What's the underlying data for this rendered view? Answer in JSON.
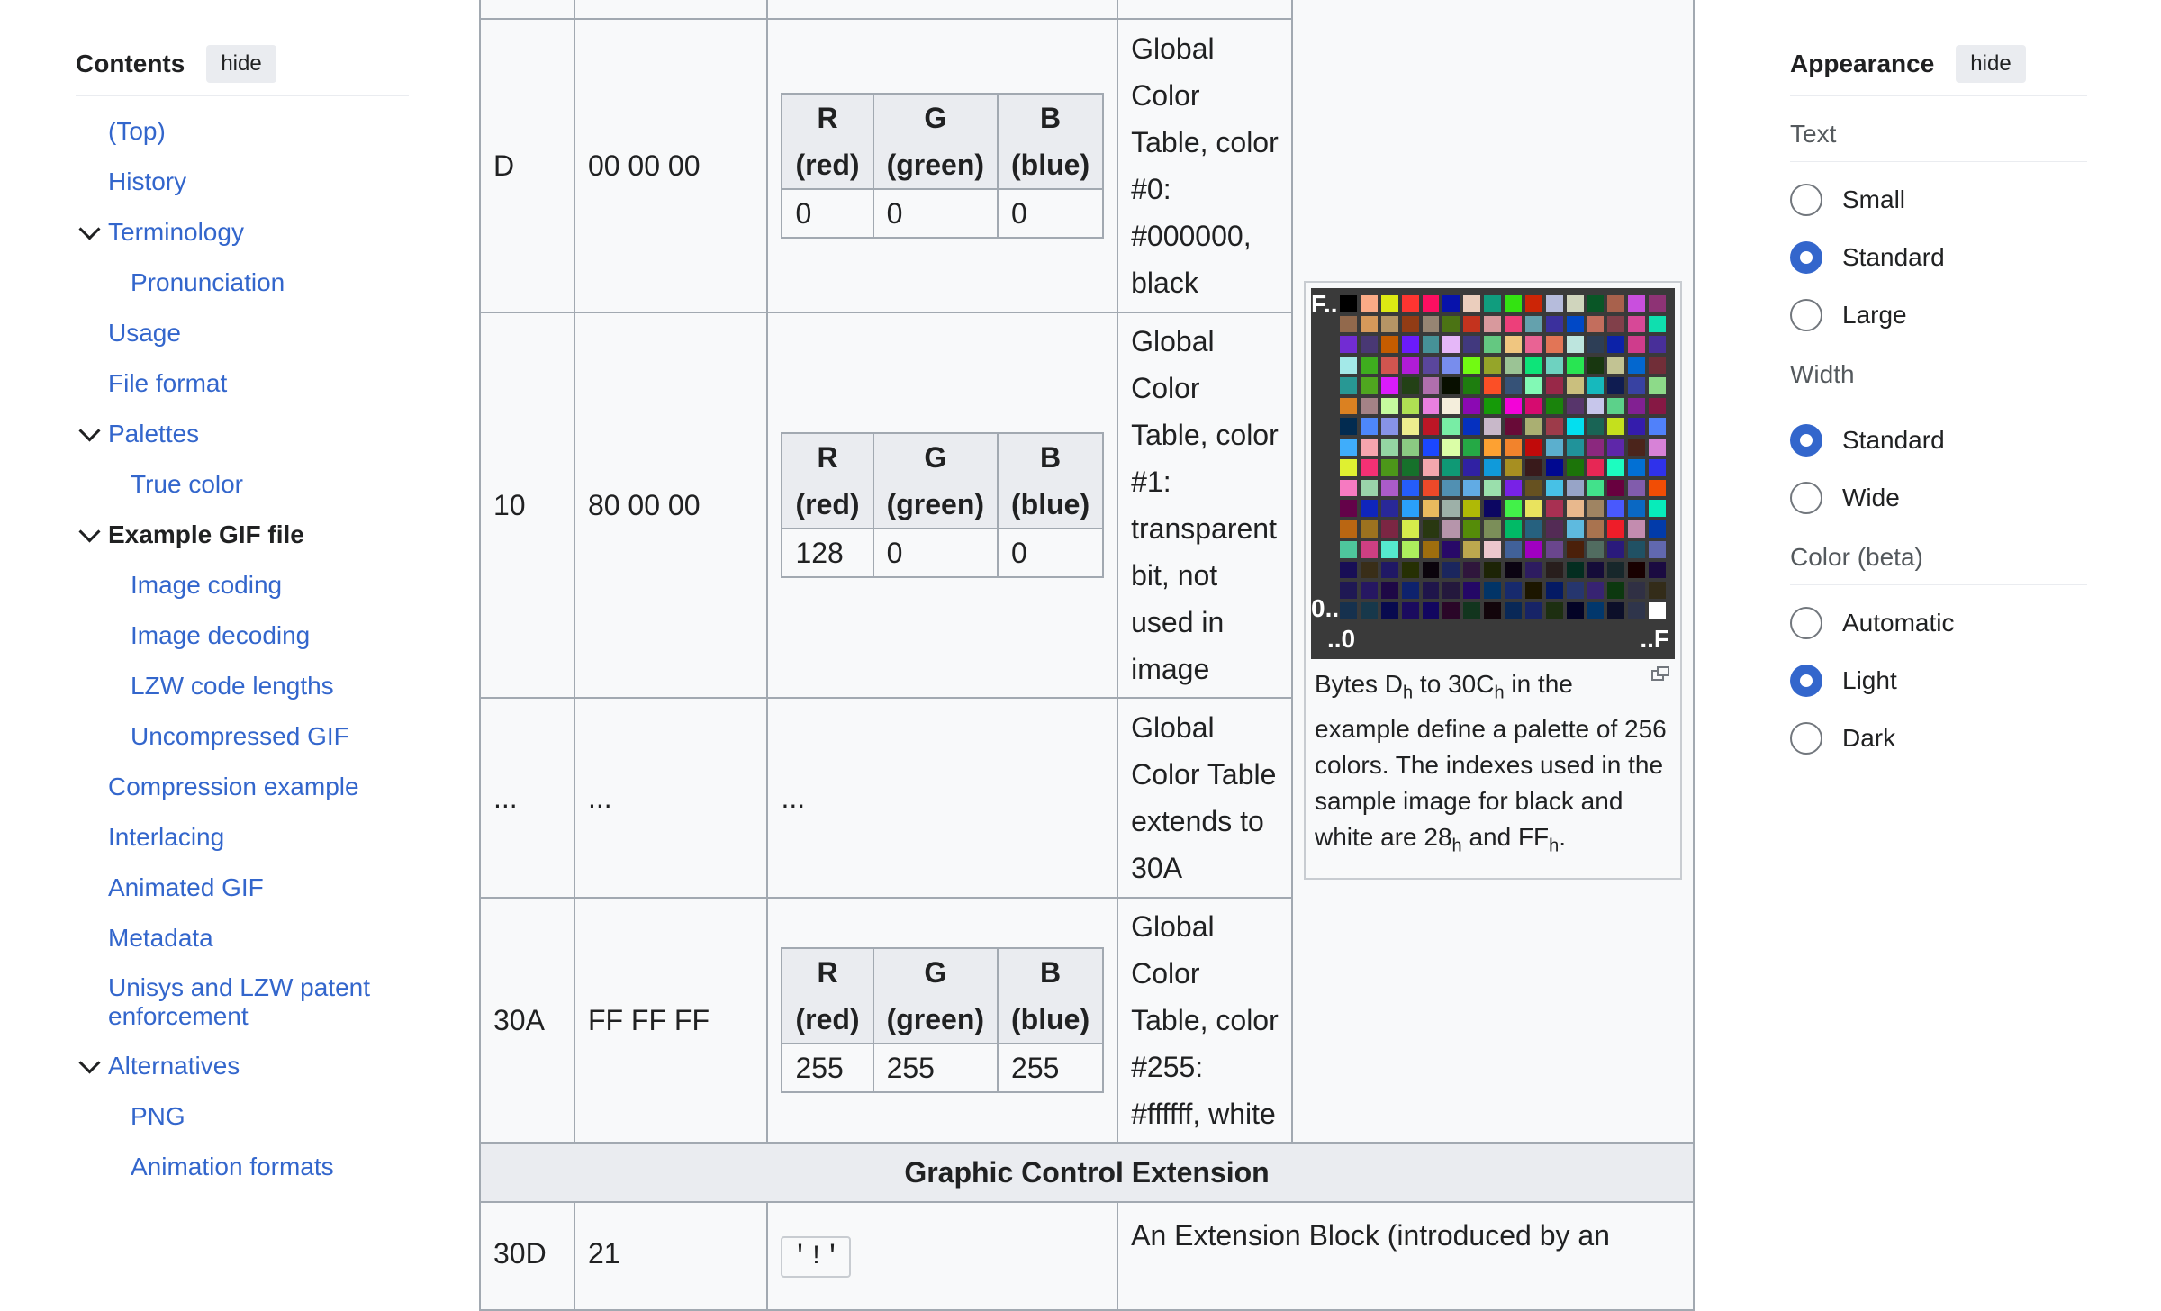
{
  "toc": {
    "title": "Contents",
    "hide_label": "hide",
    "items": [
      {
        "label": "(Top)"
      },
      {
        "label": "History"
      },
      {
        "label": "Terminology"
      },
      {
        "label": "Pronunciation"
      },
      {
        "label": "Usage"
      },
      {
        "label": "File format"
      },
      {
        "label": "Palettes"
      },
      {
        "label": "True color"
      },
      {
        "label": "Example GIF file"
      },
      {
        "label": "Image coding"
      },
      {
        "label": "Image decoding"
      },
      {
        "label": "LZW code lengths"
      },
      {
        "label": "Uncompressed GIF"
      },
      {
        "label": "Compression example"
      },
      {
        "label": "Interlacing"
      },
      {
        "label": "Animated GIF"
      },
      {
        "label": "Metadata"
      },
      {
        "label": "Unisys and LZW patent enforcement"
      },
      {
        "label": "Alternatives"
      },
      {
        "label": "PNG"
      },
      {
        "label": "Animation formats"
      }
    ]
  },
  "table": {
    "rgb_headers": {
      "r": "R",
      "r_sub": "(red)",
      "g": "G",
      "g_sub": "(green)",
      "b": "B",
      "b_sub": "(blue)"
    },
    "rows": [
      {
        "offset": "D",
        "bytes": "00 00 00",
        "r": "0",
        "g": "0",
        "b": "0",
        "desc": "Global Color Table, color #0: #000000, black"
      },
      {
        "offset": "10",
        "bytes": "80 00 00",
        "r": "128",
        "g": "0",
        "b": "0",
        "desc": "Global Color Table, color #1: transparent bit, not used in image"
      },
      {
        "offset": "...",
        "bytes": "...",
        "value": "...",
        "desc": "Global Color Table extends to 30A"
      },
      {
        "offset": "30A",
        "bytes": "FF FF FF",
        "r": "255",
        "g": "255",
        "b": "255",
        "desc": "Global Color Table, color #255: #ffffff, white"
      }
    ],
    "section": "Graphic Control Extension",
    "last_row": {
      "offset": "30D",
      "bytes": "21",
      "code": "'!'",
      "desc": "An Extension Block (introduced by an"
    }
  },
  "thumb": {
    "label_top": "F..",
    "label_left": "0..",
    "label_bottom_left": "..0",
    "label_bottom_right": "..F",
    "caption": {
      "p1": "Bytes D",
      "s1": "h",
      "p2": " to 30C",
      "s2": "h",
      "p3": " in the example define a palette of 256 colors. The indexes used in the sample image for black and white are 28",
      "s3": "h",
      "p4": " and FF",
      "s4": "h",
      "p5": "."
    }
  },
  "appearance": {
    "title": "Appearance",
    "hide_label": "hide",
    "groups": [
      {
        "label": "Text",
        "options": [
          {
            "label": "Small"
          },
          {
            "label": "Standard"
          },
          {
            "label": "Large"
          }
        ],
        "selected": "Standard"
      },
      {
        "label": "Width",
        "options": [
          {
            "label": "Standard"
          },
          {
            "label": "Wide"
          }
        ],
        "selected": "Standard"
      },
      {
        "label": "Color (beta)",
        "options": [
          {
            "label": "Automatic"
          },
          {
            "label": "Light"
          },
          {
            "label": "Dark"
          }
        ],
        "selected": "Light"
      }
    ]
  },
  "colors": {
    "link": "#3366cc",
    "accent": "#3366cc",
    "border": "#a2a9b1",
    "header_bg": "#eaecf0"
  }
}
